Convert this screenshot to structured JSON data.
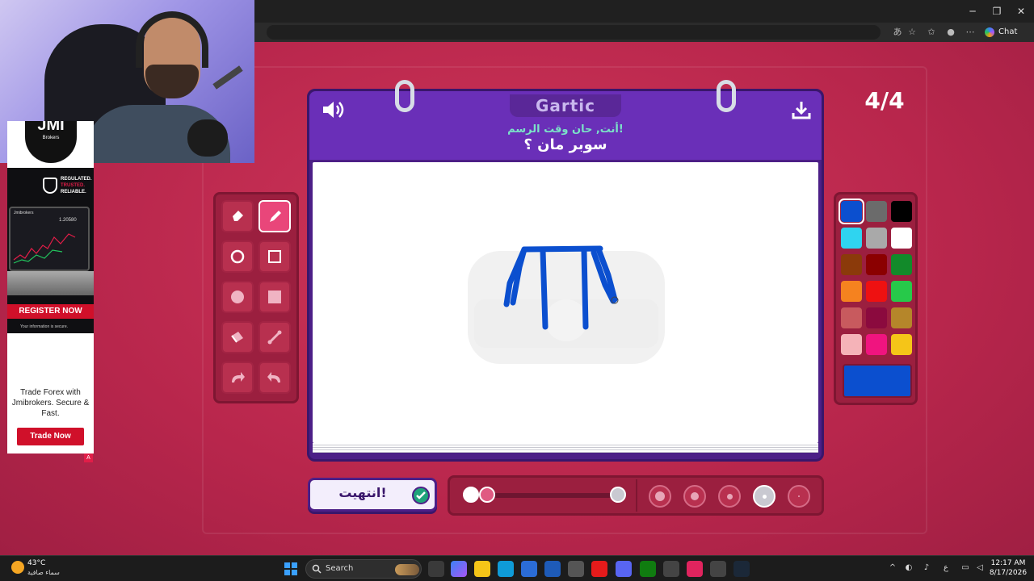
{
  "browser": {
    "chat_label": "Chat",
    "minimize_icon": "minimize-icon",
    "maximize_icon": "maximize-icon",
    "close_icon": "close-icon"
  },
  "ad": {
    "brand": "JMI",
    "brand_sub": "Brokers",
    "tagline_1": "REGULATED.",
    "tagline_2": "TRUSTED.",
    "tagline_3": "RELIABLE.",
    "platform": "Jmibrokers",
    "price": "1.20580",
    "register": "REGISTER NOW",
    "secure_note": "Your information is secure.",
    "body": "Trade Forex with Jmibrokers. Secure & Fast.",
    "cta": "Trade Now",
    "marker": "A"
  },
  "game": {
    "logo": "Gartic",
    "subtitle": "أنت, حان وقت الرسم!",
    "word": "سوبر مان ؟",
    "round": "4/4",
    "done_label": "انتهيت!",
    "accent": "#4c1f87",
    "header_color": "#6a2fb8",
    "background": "#c72d52"
  },
  "tools": [
    {
      "name": "eraser-tool",
      "icon": "eraser-icon",
      "selected": false
    },
    {
      "name": "pencil-tool",
      "icon": "pencil-icon",
      "selected": true
    },
    {
      "name": "circle-outline-tool",
      "icon": "circle-outline-icon",
      "selected": false
    },
    {
      "name": "square-outline-tool",
      "icon": "square-outline-icon",
      "selected": false
    },
    {
      "name": "circle-filled-tool",
      "icon": "circle-filled-icon",
      "selected": false
    },
    {
      "name": "square-filled-tool",
      "icon": "square-filled-icon",
      "selected": false
    },
    {
      "name": "fill-bucket-tool",
      "icon": "bucket-icon",
      "selected": false
    },
    {
      "name": "line-tool",
      "icon": "line-icon",
      "selected": false
    },
    {
      "name": "undo-tool",
      "icon": "undo-icon",
      "selected": false
    },
    {
      "name": "redo-tool",
      "icon": "redo-icon",
      "selected": false
    }
  ],
  "palette": {
    "colors": [
      "#0b4fcf",
      "#6b6b6b",
      "#000000",
      "#2fd4f0",
      "#a9a9a9",
      "#ffffff",
      "#8b3a0a",
      "#8b0000",
      "#128a2a",
      "#f5821f",
      "#ee1111",
      "#27c94a",
      "#c85a5e",
      "#8b0a3e",
      "#b5862a",
      "#f5b3b8",
      "#f0147f",
      "#f5c518"
    ],
    "selected_index": 0,
    "current_color": "#0b4fcf"
  },
  "controls": {
    "opacity_fraction": 0.0,
    "brush_size_selected_index": 3,
    "brush_sizes": 5
  },
  "taskbar": {
    "temperature": "43°C",
    "weather": "سماء صافية",
    "search_label": "Search",
    "time": "12:17 AM",
    "date": "8/17/2026",
    "lang": "ع"
  }
}
